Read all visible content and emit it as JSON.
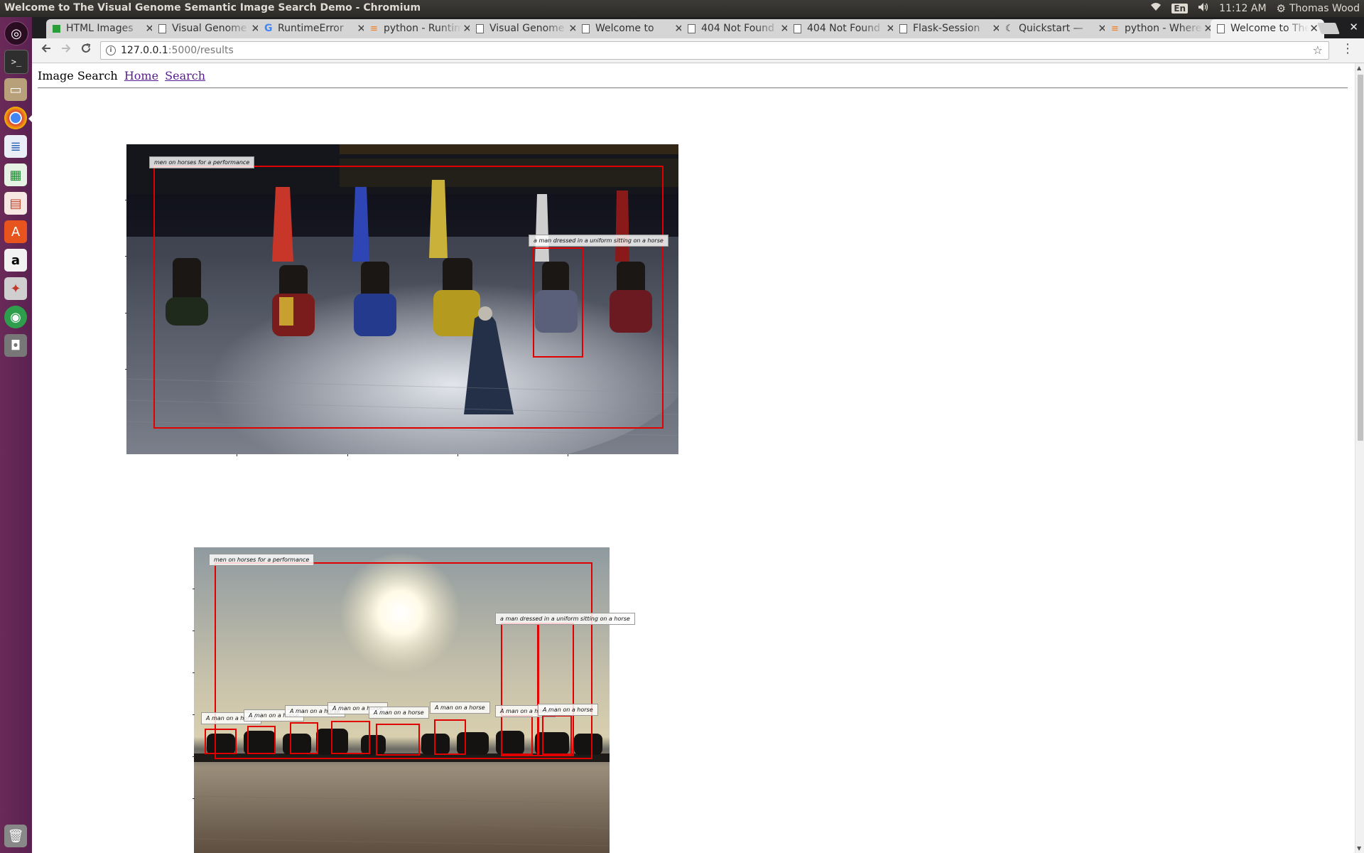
{
  "window": {
    "title": "Welcome to The Visual Genome Semantic Image Search Demo - Chromium"
  },
  "panel": {
    "keyboard": "En",
    "time": "11:12 AM",
    "user": "Thomas Wood"
  },
  "launcher": {
    "items": [
      {
        "name": "dash-icon",
        "glyph": "◎"
      },
      {
        "name": "terminal-icon",
        "glyph": ">_"
      },
      {
        "name": "files-icon",
        "glyph": "▭"
      },
      {
        "name": "chromium-icon",
        "glyph": ""
      },
      {
        "name": "libreoffice-writer-icon",
        "glyph": "≣"
      },
      {
        "name": "libreoffice-calc-icon",
        "glyph": "▦"
      },
      {
        "name": "libreoffice-impress-icon",
        "glyph": "▤"
      },
      {
        "name": "software-center-icon",
        "glyph": "A"
      },
      {
        "name": "amazon-icon",
        "glyph": "a"
      },
      {
        "name": "system-settings-icon",
        "glyph": "✦"
      },
      {
        "name": "app-green-icon",
        "glyph": "◉"
      },
      {
        "name": "screenshot-icon",
        "glyph": "◘"
      }
    ],
    "trash_glyph": "🗑"
  },
  "tabs": [
    {
      "label": "HTML Images",
      "favicon": "w3"
    },
    {
      "label": "Visual Genome",
      "favicon": "page"
    },
    {
      "label": "RuntimeError",
      "favicon": "google"
    },
    {
      "label": "python - Runtime",
      "favicon": "so"
    },
    {
      "label": "Visual Genome",
      "favicon": "page"
    },
    {
      "label": "Welcome to",
      "favicon": "page"
    },
    {
      "label": "404 Not Found",
      "favicon": "page"
    },
    {
      "label": "404 Not Found",
      "favicon": "page"
    },
    {
      "label": "Flask-Session",
      "favicon": "page"
    },
    {
      "label": "Quickstart —",
      "favicon": "moon"
    },
    {
      "label": "python - Where",
      "favicon": "so"
    },
    {
      "label": "Welcome to The",
      "favicon": "page",
      "active": true
    }
  ],
  "toolbar": {
    "url_host": "127.0.0.1",
    "url_path": ":5000/results"
  },
  "page": {
    "site_title": "Image Search",
    "nav": [
      {
        "label": "Home"
      },
      {
        "label": "Search"
      }
    ]
  },
  "results": [
    {
      "labels": [
        "men on horses for a performance",
        "a man dressed in a uniform sitting on a horse"
      ]
    },
    {
      "labels": [
        "men on horses for a performance",
        "a man dressed in a uniform sitting on a horse",
        "A man on a horse",
        "A man on a horse",
        "A man on a horse",
        "A man on a horse",
        "A man on a horse",
        "A man on a horse",
        "A man on a horse",
        "A man on a horse"
      ]
    }
  ],
  "colors": {
    "bbox": "#e00000",
    "launcher": "#5e2750",
    "link": "#551a8b"
  }
}
